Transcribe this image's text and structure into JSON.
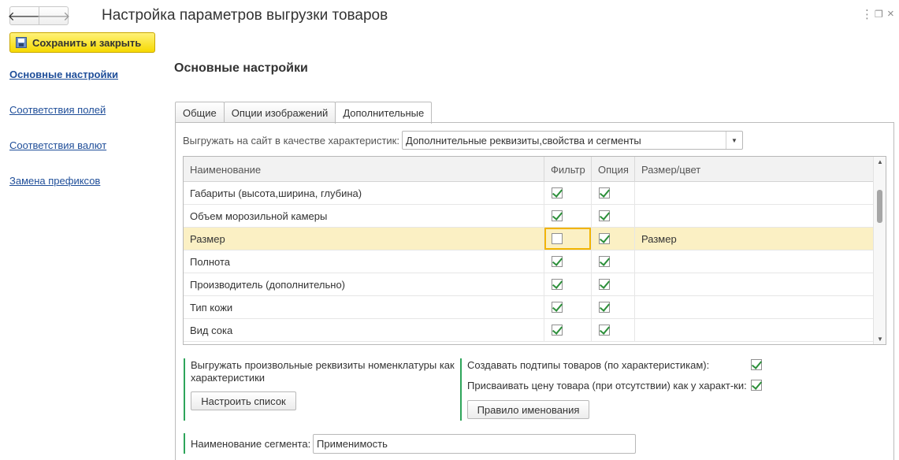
{
  "header": {
    "title": "Настройка параметров выгрузки товаров",
    "back_icon": "arrow-left-icon",
    "forward_icon": "arrow-right-icon",
    "more_icon": "more-vertical-icon",
    "restore_icon": "restore-window-icon",
    "close_icon": "close-icon"
  },
  "toolbar": {
    "save_close_label": "Сохранить и закрыть",
    "save_icon": "floppy-disk-icon",
    "accent_color": "#f6d900"
  },
  "sidebar": {
    "items": [
      {
        "label": "Основные настройки",
        "active": true
      },
      {
        "label": "Соответствия полей",
        "active": false
      },
      {
        "label": "Соответствия валют",
        "active": false
      },
      {
        "label": "Замена префиксов",
        "active": false
      }
    ]
  },
  "main": {
    "section_title": "Основные настройки",
    "tabs": [
      {
        "label": "Общие",
        "active": false
      },
      {
        "label": "Опции изображений",
        "active": false
      },
      {
        "label": "Дополнительные",
        "active": true
      }
    ],
    "characteristics_label": "Выгружать на сайт в качестве характеристик:",
    "characteristics_value": "Дополнительные реквизиты,свойства и сегменты",
    "table": {
      "columns": [
        "Наименование",
        "Фильтр",
        "Опция",
        "Размер/цвет"
      ],
      "rows": [
        {
          "name": "Габариты (высота,ширина, глубина)",
          "filter": true,
          "option": true,
          "size": "",
          "selected": false
        },
        {
          "name": "Объем морозильной камеры",
          "filter": true,
          "option": true,
          "size": "",
          "selected": false
        },
        {
          "name": "Размер",
          "filter": false,
          "option": true,
          "size": "Размер",
          "selected": true
        },
        {
          "name": "Полнота",
          "filter": true,
          "option": true,
          "size": "",
          "selected": false
        },
        {
          "name": "Производитель (дополнительно)",
          "filter": true,
          "option": true,
          "size": "",
          "selected": false
        },
        {
          "name": "Тип кожи",
          "filter": true,
          "option": true,
          "size": "",
          "selected": false
        },
        {
          "name": "Вид сока",
          "filter": true,
          "option": true,
          "size": "",
          "selected": false
        }
      ]
    },
    "export_attrs_text": "Выгружать произвольные реквизиты номенклатуры как характеристики",
    "configure_list_label": "Настроить список",
    "create_subtypes_label": "Создавать подтипы товаров (по характеристикам):",
    "create_subtypes_checked": true,
    "assign_price_label": "Присваивать цену товара (при отсутствии) как у характ-ки:",
    "assign_price_checked": true,
    "naming_rule_label": "Правило именования",
    "segment_name_label": "Наименование сегмента:",
    "segment_name_value": "Применимость"
  }
}
